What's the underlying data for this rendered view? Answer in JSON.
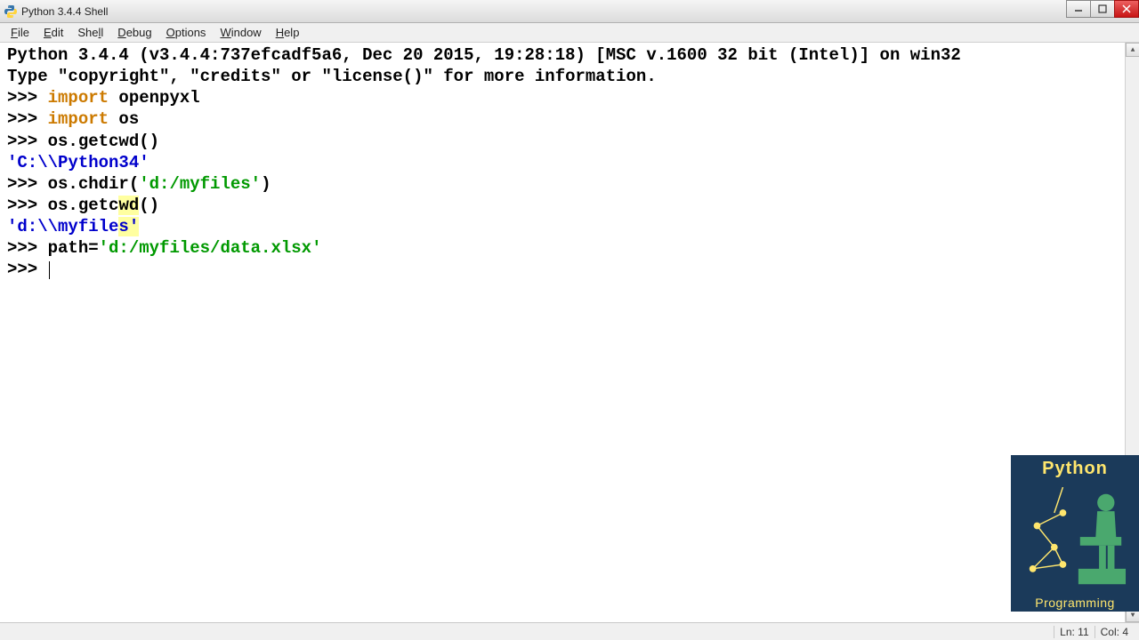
{
  "titlebar": {
    "title": "Python 3.4.4 Shell"
  },
  "menubar": {
    "items": [
      "File",
      "Edit",
      "Shell",
      "Debug",
      "Options",
      "Window",
      "Help"
    ]
  },
  "shell": {
    "banner1": "Python 3.4.4 (v3.4.4:737efcadf5a6, Dec 20 2015, 19:28:18) [MSC v.1600 32 bit (Intel)] on win32",
    "banner2": "Type \"copyright\", \"credits\" or \"license()\" for more information.",
    "prompt": ">>> ",
    "kw_import": "import",
    "line1_rest": " openpyxl",
    "line2_rest": " os",
    "line3": "os.getcwd()",
    "out1": "'C:\\\\Python34'",
    "line4_pre": "os.chdir(",
    "line4_str": "'d:/myfiles'",
    "line4_post": ")",
    "line5_pre": "os.getc",
    "line5_hl": "wd",
    "line5_post": "()",
    "out2_pre": "'d:\\\\myfile",
    "out2_hl": "s'",
    "line6_pre": "path=",
    "line6_str": "'d:/myfiles/data.xlsx'"
  },
  "status": {
    "line": "Ln: 11",
    "col": "Col: 4"
  },
  "logo": {
    "top": "Python",
    "bottom": "Programming"
  }
}
